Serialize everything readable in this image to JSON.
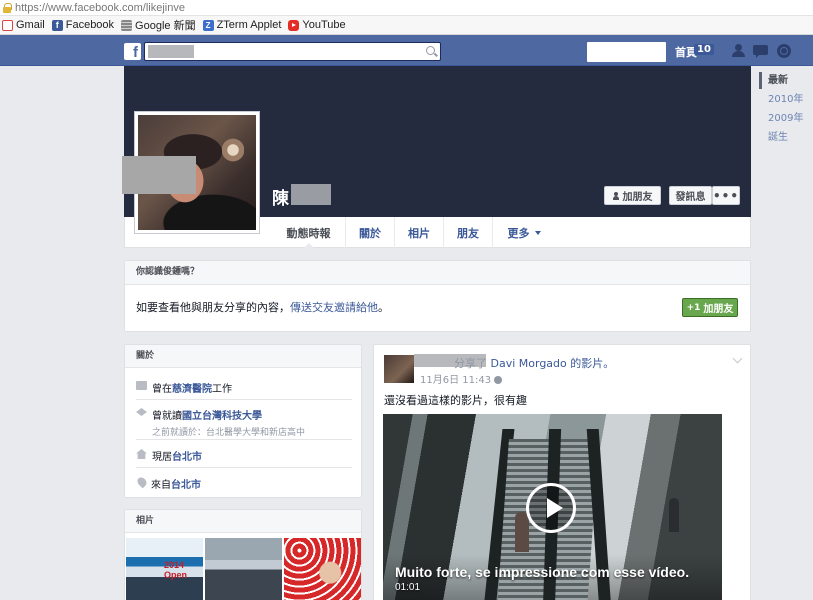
{
  "browser": {
    "url_scheme": "https://",
    "url_host": "www.facebook.com",
    "url_path": "/likejinve",
    "bookmarks": [
      {
        "label": "Gmail",
        "icon": "gmail-icon"
      },
      {
        "label": "Facebook",
        "icon": "facebook-icon",
        "glyph": "f"
      },
      {
        "label": "Google 新聞",
        "icon": "google-news-icon"
      },
      {
        "label": "ZTerm Applet",
        "icon": "zterm-icon",
        "glyph": "Z"
      },
      {
        "label": "YouTube",
        "icon": "youtube-icon"
      }
    ]
  },
  "topbar": {
    "logo": "f",
    "home_label": "首頁",
    "home_count": "10",
    "accent_color": "#4e69a2"
  },
  "profile": {
    "name": "陳",
    "add_friend_label": "加朋友",
    "message_label": "發訊息",
    "more_label": "•••",
    "tabs": [
      {
        "label": "動態時報"
      },
      {
        "label": "關於"
      },
      {
        "label": "相片"
      },
      {
        "label": "朋友"
      },
      {
        "label": "更多"
      }
    ]
  },
  "timeline_nav": [
    "最新",
    "2010年",
    "2009年",
    "誕生"
  ],
  "know_box": {
    "title": "你認識俊鍾嗎？",
    "text_before": "如要查看他與朋友分享的內容，",
    "link": "傳送交友邀請給他",
    "text_after": "。",
    "button_label": "加朋友",
    "button_icon": "+1",
    "button_color": "#69a74e"
  },
  "about": {
    "title": "關於",
    "work_prefix": "曾在",
    "work_place": "慈濟醫院",
    "work_suffix": "工作",
    "edu_prefix": "曾就讀",
    "edu_school": "國立台灣科技大學",
    "edu_previous": "之前就讀於：台北醫學大學和新店高中",
    "lives_prefix": "現居",
    "lives_city": "台北市",
    "from_prefix": "來自",
    "from_city": "台北市"
  },
  "photos": {
    "title": "相片",
    "thumb_text": "2014 Open"
  },
  "post": {
    "action": "分享了",
    "shared_from": "Davi Morgado",
    "object": "的影片。",
    "time": "11月6日 11:43",
    "text": "還沒看過這樣的影片，很有趣",
    "video_caption": "Muito forte, se impressione com esse vídeo.",
    "video_duration": "01:01"
  }
}
